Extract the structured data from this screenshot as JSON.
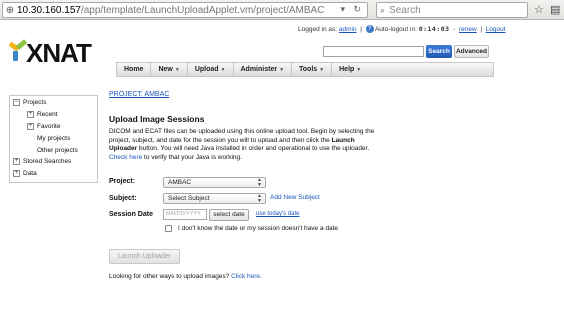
{
  "browser": {
    "url_host": "10.30.160.157",
    "url_path": "/app/template/LaunchUploadApplet.vm/project/AMBAC",
    "search_placeholder": "Search"
  },
  "header": {
    "logged_in_label": "Logged in as:",
    "username": "admin",
    "auto_logout_label": "Auto-logout in:",
    "timer": "0:14:03",
    "renew_label": "renew",
    "logout_label": "Logout",
    "logo_text": "XNAT",
    "search_button": "Search",
    "advanced_button": "Advanced"
  },
  "nav": {
    "items": [
      {
        "label": "Home",
        "caret": false
      },
      {
        "label": "New",
        "caret": true
      },
      {
        "label": "Upload",
        "caret": true
      },
      {
        "label": "Administer",
        "caret": true
      },
      {
        "label": "Tools",
        "caret": true
      },
      {
        "label": "Help",
        "caret": true
      }
    ]
  },
  "tree": {
    "projects": "Projects",
    "recent": "Recent",
    "favorite": "Favorite",
    "my_projects": "My projects",
    "other_projects": "Other projects",
    "stored_searches": "Stored Searches",
    "data": "Data",
    "expanded_glyph": "−",
    "collapsed_glyph": "+"
  },
  "main": {
    "breadcrumb": "PROJECT: AMBAC",
    "title": "Upload Image Sessions",
    "desc_part1": "DICOM and ECAT files can be uploaded using this online upload tool. Begin by selecting the project, subject, and date for the session you will to upload and then click the ",
    "desc_bold1": "Launch Uploader",
    "desc_part2": " button. You will need Java installed in order and operational to use the uploader. ",
    "desc_link": "Check here",
    "desc_part3": " to verify that your Java is working.",
    "project_label": "Project:",
    "project_value": "AMBAC",
    "subject_label": "Subject:",
    "subject_value": "Select Subject",
    "add_subject_link": "Add New Subject",
    "session_date_label": "Session Date",
    "date_placeholder": "MM/DD/YYYY",
    "select_date_button": "select date",
    "use_today_link": "use today's date",
    "no_date_checkbox_label": "I don't know the date or my session doesn't have a date",
    "launch_button": "Launch Uploader",
    "other_ways_text": "Looking for other ways to upload images? ",
    "other_ways_link": "Click here."
  }
}
